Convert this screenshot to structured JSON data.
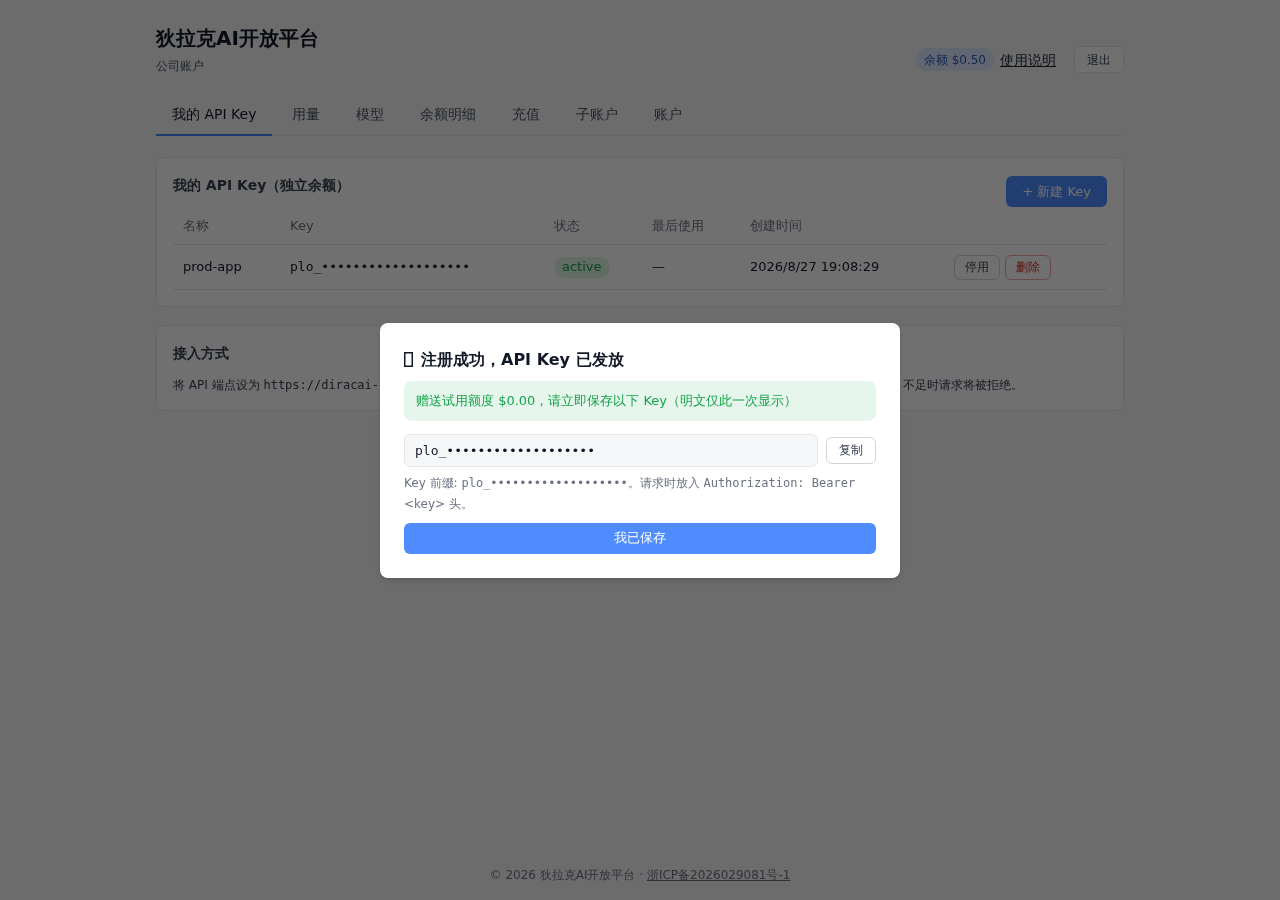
{
  "header": {
    "title": "狄拉克AI开放平台",
    "subtitle": "公司账户",
    "balance": "余额 $0.50",
    "help_link": "使用说明",
    "logout_button": "退出"
  },
  "tabs": [
    {
      "label": "我的 API Key",
      "selected": true
    },
    {
      "label": "用量",
      "selected": false
    },
    {
      "label": "模型",
      "selected": false
    },
    {
      "label": "余额明细",
      "selected": false
    },
    {
      "label": "充值",
      "selected": false
    },
    {
      "label": "子账户",
      "selected": false
    },
    {
      "label": "账户",
      "selected": false
    }
  ],
  "keys_card": {
    "title": "我的 API Key（独立余额）",
    "new_button": "+ 新建 Key",
    "columns": [
      "名称",
      "Key",
      "状态",
      "最后使用",
      "创建时间"
    ],
    "rows": [
      {
        "name": "prod-app",
        "key": "plo_•••••••••••••••••••",
        "status": "active",
        "last_used": "—",
        "created": "2026/8/27 19:08:29",
        "actions": [
          {
            "label": "停用",
            "kind": "neutral"
          },
          {
            "label": "删除",
            "kind": "danger"
          }
        ]
      }
    ]
  },
  "integration_card": {
    "title": "接入方式",
    "text_start": [
      {
        "kind": "text",
        "text": "将 API 端点设为 "
      },
      {
        "kind": "code",
        "text": "https://diracai-"
      }
    ],
    "text_end": "不足时请求将被拒绝。"
  },
  "modal": {
    "title": "注册成功，API Key 已发放",
    "notice": "赠送试用额度 $0.00，请立即保存以下 Key（明文仅此一次显示）",
    "key_value": "plo_•••••••••••••••••••",
    "copy_button": "复制",
    "hint": [
      {
        "kind": "text",
        "text": "Key 前缀: "
      },
      {
        "kind": "code",
        "text": "plo_•••••••••••••••••••"
      },
      {
        "kind": "text",
        "text": "。请求时放入 "
      },
      {
        "kind": "code",
        "text": "Authorization: Bearer"
      },
      {
        "kind": "text",
        "text": " <key> 头。"
      }
    ],
    "confirm_button": "我已保存"
  },
  "footer": {
    "text": "© 2026 狄拉克AI开放平台 · ",
    "link": "浙ICP备2026029081号-1"
  }
}
